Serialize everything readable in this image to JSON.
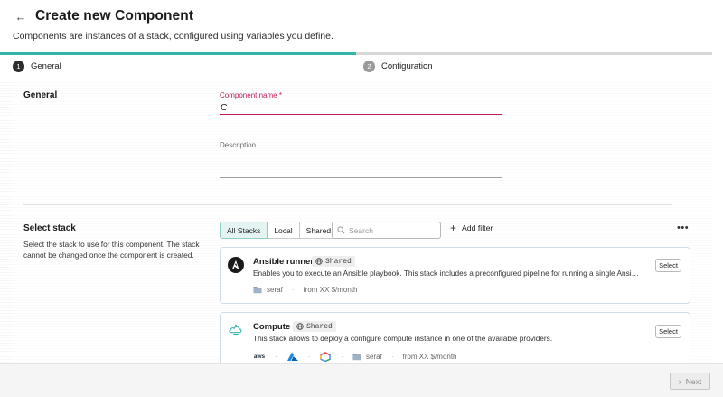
{
  "header": {
    "title": "Create new Component",
    "subtitle": "Components are instances of a stack, configured using variables you define."
  },
  "progress": {
    "fraction": 0.5
  },
  "steps": [
    {
      "number": "1",
      "label": "General",
      "state": "current"
    },
    {
      "number": "2",
      "label": "Configuration",
      "state": "upcoming"
    }
  ],
  "general": {
    "title": "General",
    "component_name": {
      "label": "Component name *",
      "value": "C"
    },
    "description": {
      "label": "Description",
      "value": ""
    }
  },
  "select_stack": {
    "title": "Select stack",
    "description": "Select the stack to use for this component. The stack cannot be changed once the component is created.",
    "filters": [
      "All Stacks",
      "Local",
      "Shared"
    ],
    "active_filter": "All Stacks",
    "search": {
      "placeholder": "Search",
      "value": ""
    },
    "add_filter_label": "Add filter",
    "more_label": "•••",
    "stacks": [
      {
        "name": "Ansible runner",
        "badge": "Shared",
        "description": "Enables you to execute an Ansible playbook. This stack includes a preconfigured pipeline for running a single Ansible pl...",
        "owner": "seraf",
        "price": "from XX $/month",
        "logo": "ansible-logo",
        "select_label": "Select"
      },
      {
        "name": "Compute",
        "badge": "Shared",
        "description": "This stack allows to deploy a configure compute instance in one of the available providers.",
        "owner": "seraf",
        "price": "from XX $/month",
        "logo": "compute-logo",
        "providers": [
          "aws",
          "azure",
          "gcp"
        ],
        "provider_aws_text": "aws",
        "select_label": "Select"
      }
    ]
  },
  "footer": {
    "next_label": "Next"
  },
  "colors": {
    "accent": "#35b5a8",
    "error": "#c2185b",
    "filter_active_bg": "#e5f4f2"
  }
}
